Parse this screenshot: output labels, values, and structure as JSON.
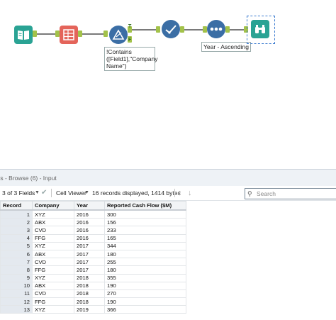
{
  "workflow": {
    "tools": [
      {
        "name": "input-tool",
        "icon": "book-icon",
        "color": "#2aa394"
      },
      {
        "name": "select-tool",
        "icon": "table-icon",
        "color": "#e4645a"
      },
      {
        "name": "filter-tool",
        "icon": "delta-icon",
        "color": "#3b6ea5"
      },
      {
        "name": "sample-tool",
        "icon": "check-path-icon",
        "color": "#3b6ea5"
      },
      {
        "name": "sort-tool",
        "icon": "dots-icon",
        "color": "#3b6ea5"
      },
      {
        "name": "browse-tool",
        "icon": "binoculars-icon",
        "color": "#2aa394"
      }
    ],
    "filter_annotation": "!Contains ([Field1],\"Company Name\")",
    "sort_annotation": "Year - Ascending",
    "anchor_true": "T",
    "anchor_false": "F"
  },
  "results": {
    "title": "ts - Browse (6) - Input",
    "fields_label": "3 of 3 Fields",
    "viewer_label": "Cell Viewer",
    "records_label": "16 records displayed, 1414 bytes",
    "search_placeholder": "Search",
    "columns": [
      "Record",
      "Company",
      "Year",
      "Reported Cash Flow ($M)"
    ],
    "rows": [
      [
        "1",
        "XYZ",
        "2016",
        "300"
      ],
      [
        "2",
        "ABX",
        "2016",
        "156"
      ],
      [
        "3",
        "CVD",
        "2016",
        "233"
      ],
      [
        "4",
        "FFG",
        "2016",
        "165"
      ],
      [
        "5",
        "XYZ",
        "2017",
        "344"
      ],
      [
        "6",
        "ABX",
        "2017",
        "180"
      ],
      [
        "7",
        "CVD",
        "2017",
        "255"
      ],
      [
        "8",
        "FFG",
        "2017",
        "180"
      ],
      [
        "9",
        "XYZ",
        "2018",
        "355"
      ],
      [
        "10",
        "ABX",
        "2018",
        "190"
      ],
      [
        "11",
        "CVD",
        "2018",
        "270"
      ],
      [
        "12",
        "FFG",
        "2018",
        "190"
      ],
      [
        "13",
        "XYZ",
        "2019",
        "366"
      ]
    ]
  }
}
